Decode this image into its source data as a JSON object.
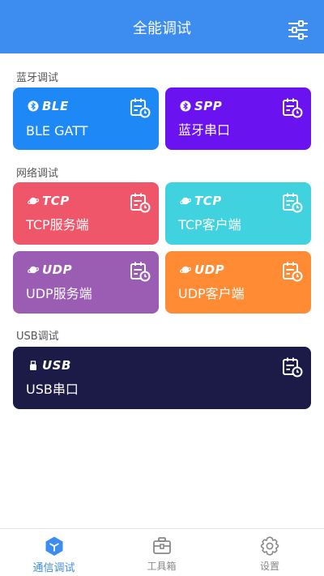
{
  "header": {
    "title": "全能调试",
    "menu_icon": "filter-sliders-icon"
  },
  "sections": [
    {
      "label": "蓝牙调试"
    },
    {
      "label": "网络调试"
    },
    {
      "label": "USB调试"
    }
  ],
  "cards": [
    {
      "tag": "BLE",
      "name": "BLE GATT",
      "tag_icon": "bluetooth-icon",
      "color": "#1e88f6"
    },
    {
      "tag": "SPP",
      "name": "蓝牙串口",
      "tag_icon": "bluetooth-icon",
      "color": "#6a12f0"
    },
    {
      "tag": "TCP",
      "name": "TCP服务端",
      "tag_icon": "planet-icon",
      "color": "#f0566a"
    },
    {
      "tag": "TCP",
      "name": "TCP客户端",
      "tag_icon": "planet-icon",
      "color": "#40d3df"
    },
    {
      "tag": "UDP",
      "name": "UDP服务端",
      "tag_icon": "planet-icon",
      "color": "#9b5cb4"
    },
    {
      "tag": "UDP",
      "name": "UDP客户端",
      "tag_icon": "planet-icon",
      "color": "#ff8b35"
    },
    {
      "tag": "USB",
      "name": "USB串口",
      "tag_icon": "usb-plug-icon",
      "color": "#1c1b48"
    }
  ],
  "tabs": [
    {
      "label": "通信调试",
      "icon": "cube-icon",
      "active": true
    },
    {
      "label": "工具箱",
      "icon": "toolbox-icon",
      "active": false
    },
    {
      "label": "设置",
      "icon": "gear-icon",
      "active": false
    }
  ],
  "colors": {
    "header": "#3d8df0",
    "active_tab": "#3d8df0",
    "inactive_tab": "#888888"
  }
}
